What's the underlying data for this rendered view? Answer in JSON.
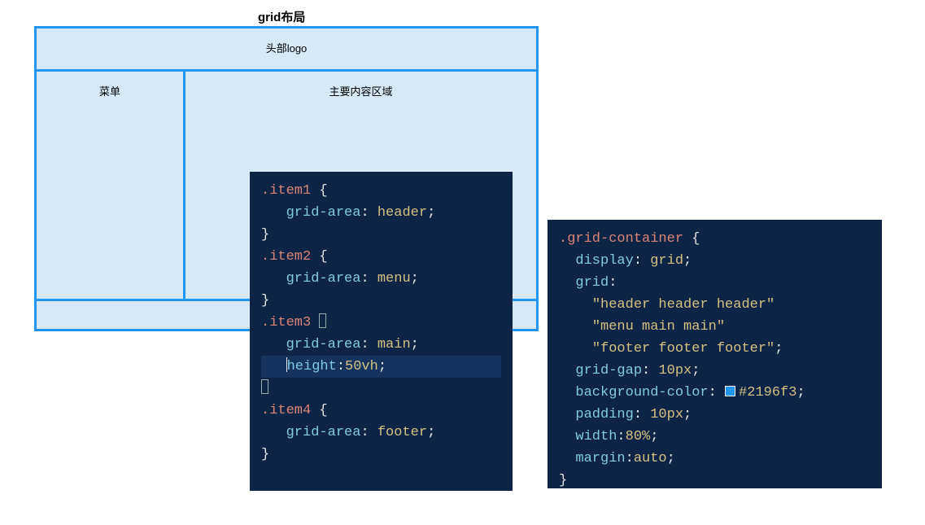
{
  "title": "grid布局",
  "demo": {
    "header": "头部logo",
    "menu": "菜单",
    "main": "主要内容区域",
    "footer": ""
  },
  "code_left": {
    "sel1": ".item1",
    "prop_ga": "grid-area",
    "val1": "header",
    "sel2": ".item2",
    "val2": "menu",
    "sel3": ".item3",
    "val3": "main",
    "prop_h": "height",
    "val_h": "50vh",
    "sel4": ".item4",
    "val4": "footer"
  },
  "code_right": {
    "sel": ".grid-container",
    "p1": "display",
    "v1": "grid",
    "p2": "grid",
    "t1": "\"header header header\"",
    "t2": "\"menu main main\"",
    "t3": "\"footer footer footer\"",
    "p3": "grid-gap",
    "v3": "10px",
    "p4": "background-color",
    "v4": "#2196f3",
    "p5": "padding",
    "v5": "10px",
    "p6": "width",
    "v6": "80%",
    "p7": "margin",
    "v7": "auto"
  }
}
